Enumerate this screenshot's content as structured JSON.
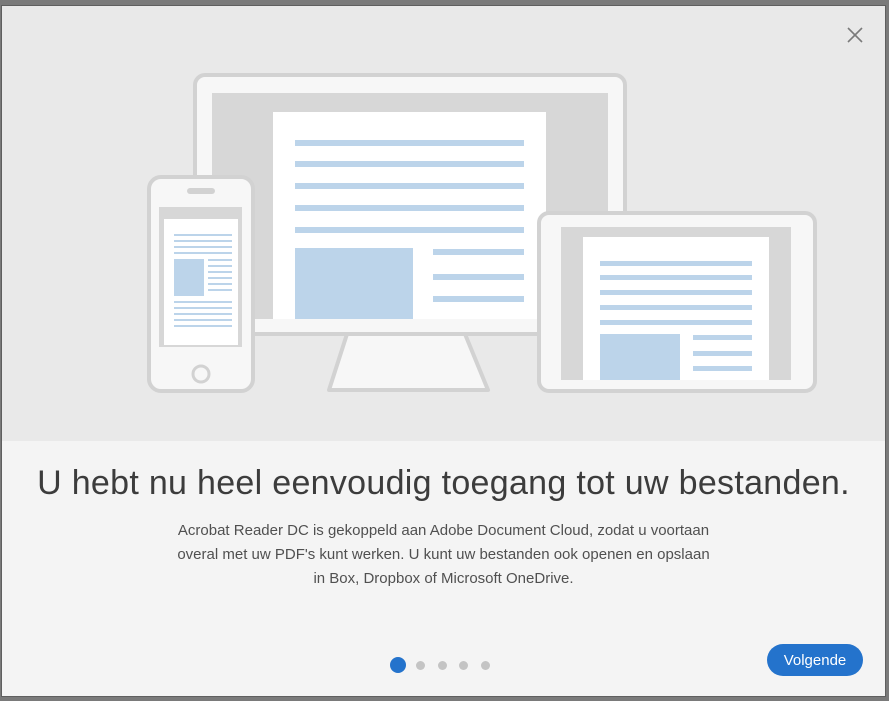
{
  "dialog": {
    "close_icon": "close-icon",
    "illustration": "devices-illustration",
    "headline": "U hebt nu heel eenvoudig toegang tot uw bestanden.",
    "description_lines": [
      "Acrobat Reader DC is gekoppeld aan Adobe Document Cloud, zodat u voortaan",
      "overal met uw PDF's kunt werken. U kunt uw bestanden ook openen en opslaan",
      "in Box, Dropbox of Microsoft OneDrive."
    ],
    "pagination": {
      "total": 5,
      "current": 1
    },
    "next_label": "Volgende"
  },
  "colors": {
    "accent": "#2473cc",
    "hero_bg": "#e9e9e9",
    "panel_bg": "#f4f4f4",
    "doc_lines": "#bcd4ea"
  }
}
